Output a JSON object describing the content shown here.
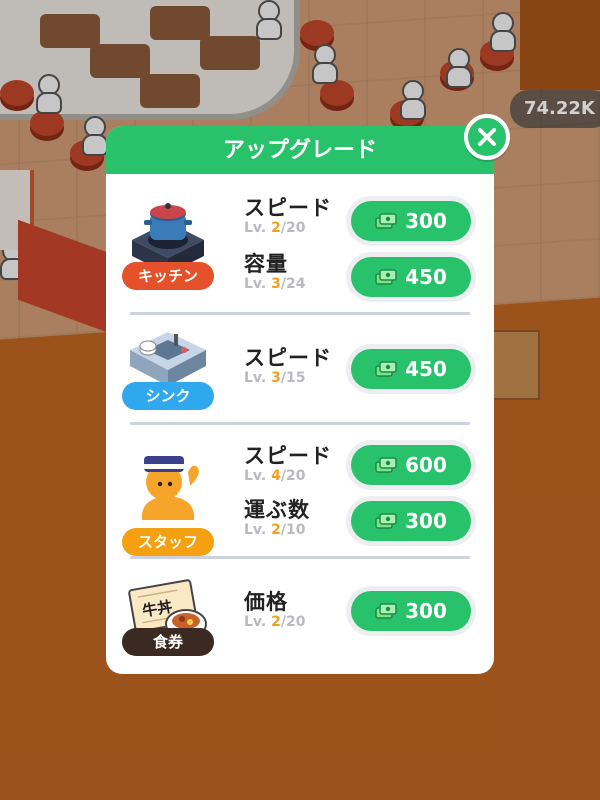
{
  "hud": {
    "money": "74.22K"
  },
  "panel": {
    "title": "アップグレード",
    "sections": [
      {
        "badge": "キッチン",
        "badge_color": "#e4512b",
        "icon": "pot-on-stove-icon",
        "stats": [
          {
            "name": "スピード",
            "lv_prefix": "Lv. ",
            "lv": "2",
            "lv_max": "/20",
            "price": "300"
          },
          {
            "name": "容量",
            "lv_prefix": "Lv. ",
            "lv": "3",
            "lv_max": "/24",
            "price": "450"
          }
        ]
      },
      {
        "badge": "シンク",
        "badge_color": "#2fa8ee",
        "icon": "sink-icon",
        "stats": [
          {
            "name": "スピード",
            "lv_prefix": "Lv. ",
            "lv": "3",
            "lv_max": "/15",
            "price": "450"
          }
        ]
      },
      {
        "badge": "スタッフ",
        "badge_color": "#f5a011",
        "icon": "staff-icon",
        "stats": [
          {
            "name": "スピード",
            "lv_prefix": "Lv. ",
            "lv": "4",
            "lv_max": "/20",
            "price": "600"
          },
          {
            "name": "運ぶ数",
            "lv_prefix": "Lv. ",
            "lv": "2",
            "lv_max": "/10",
            "price": "300"
          }
        ]
      },
      {
        "badge": "食券",
        "badge_color": "#3a2a22",
        "icon": "meal-ticket-icon",
        "ticket_text": "牛丼",
        "stats": [
          {
            "name": "価格",
            "lv_prefix": "Lv. ",
            "lv": "2",
            "lv_max": "/20",
            "price": "300"
          }
        ]
      }
    ]
  },
  "colors": {
    "accent": "#27c26a",
    "level_current": "#f0a020",
    "level_muted": "#b9b9c3"
  }
}
